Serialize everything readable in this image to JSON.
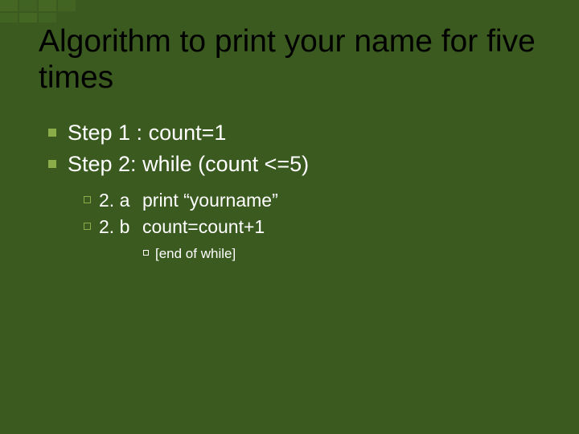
{
  "title": "Algorithm to print your name for five times",
  "steps": [
    {
      "text": "Step 1 : count=1"
    },
    {
      "text": "Step 2: while (count <=5)"
    }
  ],
  "substeps": [
    {
      "label": "2. a",
      "text": "print “yourname”"
    },
    {
      "label": "2. b",
      "text": "count=count+1"
    }
  ],
  "subsub": [
    {
      "text": "[end of while]"
    }
  ]
}
